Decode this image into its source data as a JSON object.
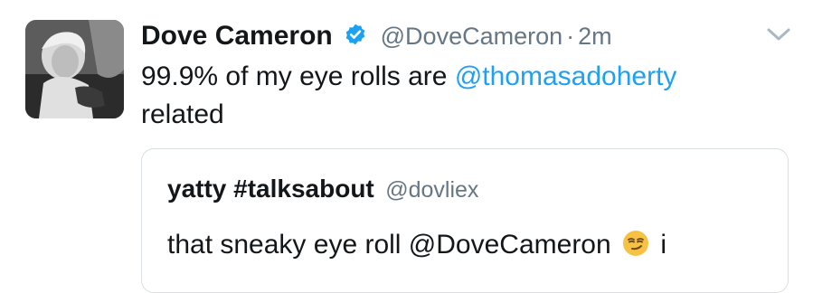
{
  "tweet": {
    "author_name": "Dove Cameron",
    "handle": "@DoveCameron",
    "separator": "·",
    "time": "2m",
    "text_before": "99.9% of my eye rolls are ",
    "mention": "@thomasadoherty",
    "text_after": " related",
    "icons": {
      "verified": "verified-badge-icon",
      "more": "chevron-down-icon"
    },
    "colors": {
      "link": "#1da1f2",
      "verified": "#1da1f2",
      "secondary_text": "#657786"
    }
  },
  "quoted_tweet": {
    "author_name": "yatty #talksabout",
    "handle": "@dovliex",
    "text_before": "that sneaky eye roll @DoveCameron ",
    "emoji": "smirking-face-emoji",
    "text_after": " i"
  }
}
